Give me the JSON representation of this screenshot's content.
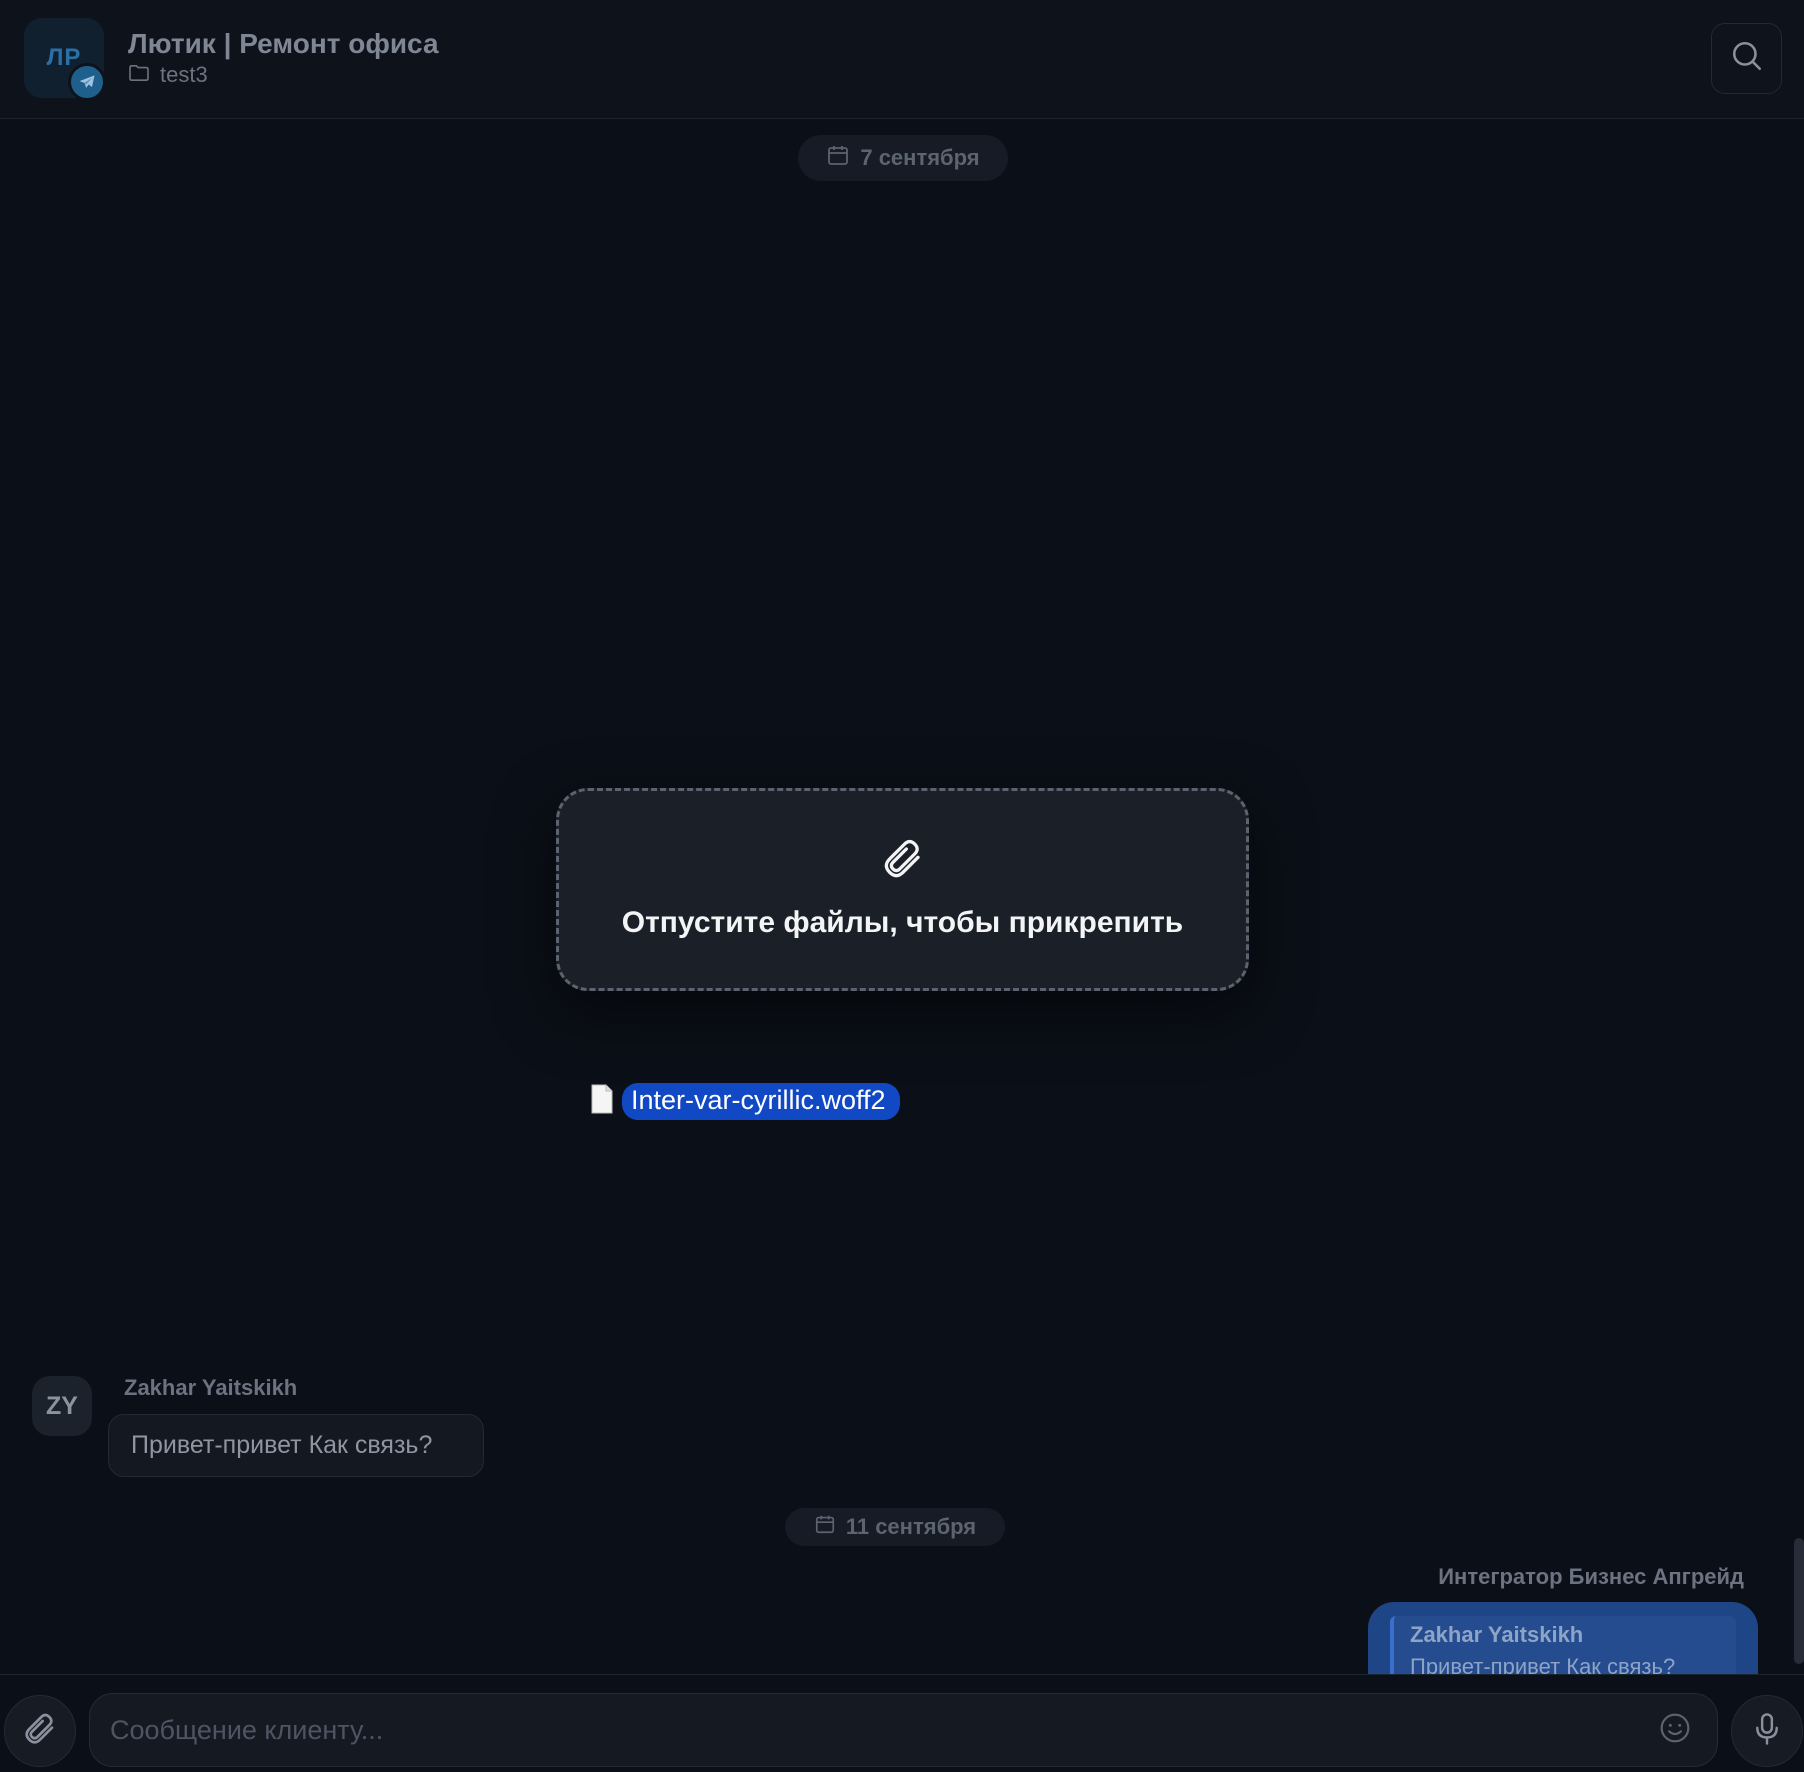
{
  "header": {
    "avatar_initials": "ЛР",
    "title": "Лютик | Ремонт офиса",
    "folder": "test3",
    "channel_icon": "telegram-icon"
  },
  "dates": {
    "first": "7 сентября",
    "second": "11 сентября"
  },
  "dropzone": {
    "icon": "paperclip-icon",
    "text": "Отпустите файлы, чтобы прикрепить"
  },
  "dragged_file": {
    "name": "Inter-var-cyrillic.woff2",
    "icon": "file-icon"
  },
  "messages": {
    "incoming": {
      "avatar_initials": "ZY",
      "sender": "Zakhar Yaitskikh",
      "text": "Привет-привет Как связь?"
    },
    "outgoing": {
      "sender": "Интегратор Бизнес Апгрейд",
      "reply_to_name": "Zakhar Yaitskikh",
      "reply_to_text": "Привет-привет Как связь?"
    }
  },
  "composer": {
    "placeholder": "Сообщение клиенту..."
  },
  "colors": {
    "background": "#0b0f17",
    "accent": "#1149c4",
    "outgoing_bubble": "#1e4585"
  }
}
